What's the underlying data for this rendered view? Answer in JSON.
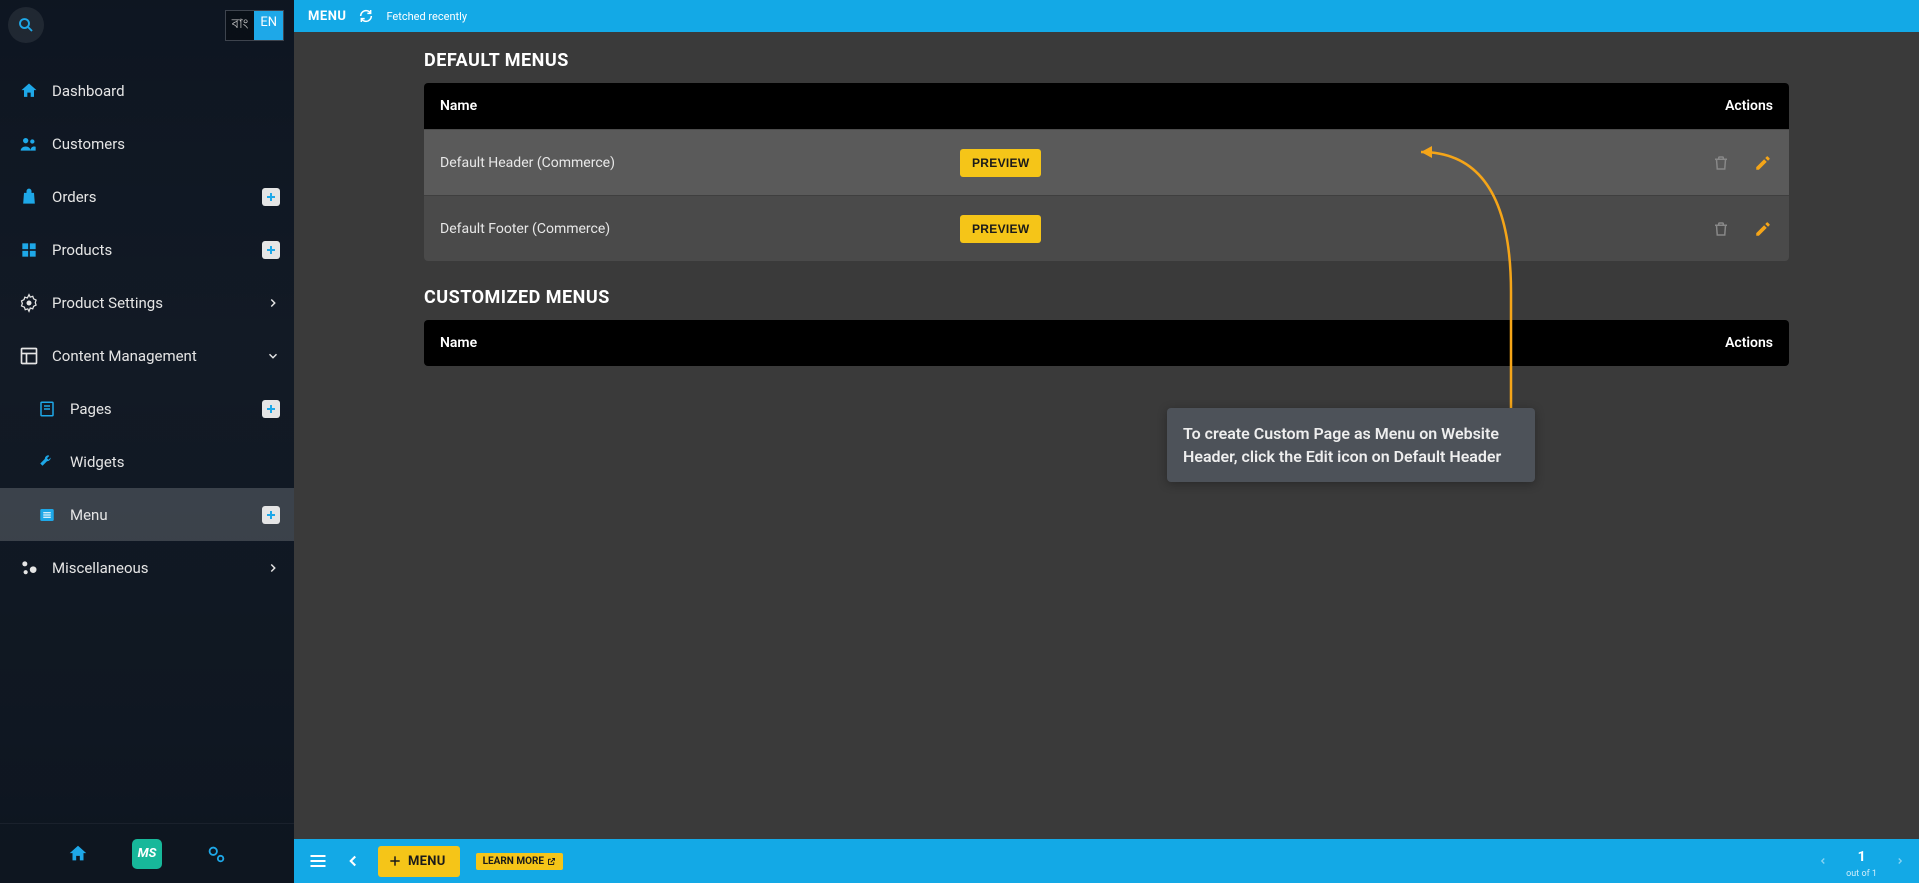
{
  "sidebar": {
    "lang": {
      "bn": "বাং",
      "en": "EN"
    },
    "items": [
      {
        "label": "Dashboard"
      },
      {
        "label": "Customers"
      },
      {
        "label": "Orders"
      },
      {
        "label": "Products"
      },
      {
        "label": "Product Settings"
      },
      {
        "label": "Content Management"
      },
      {
        "label": "Pages"
      },
      {
        "label": "Widgets"
      },
      {
        "label": "Menu"
      },
      {
        "label": "Miscellaneous"
      }
    ]
  },
  "topbar": {
    "title": "MENU",
    "status": "Fetched recently"
  },
  "main": {
    "section1": "DEFAULT MENUS",
    "section2": "CUSTOMIZED MENUS",
    "col_name": "Name",
    "col_actions": "Actions",
    "rows_default": [
      {
        "name": "Default Header (Commerce)",
        "preview": "PREVIEW"
      },
      {
        "name": "Default Footer (Commerce)",
        "preview": "PREVIEW"
      }
    ]
  },
  "tooltip": "To create Custom Page as Menu on Website Header, click the Edit icon on Default Header",
  "bottombar": {
    "menu_btn": "MENU",
    "learn_more": "LEARN MORE",
    "page_num": "1",
    "page_sub": "out of 1"
  }
}
